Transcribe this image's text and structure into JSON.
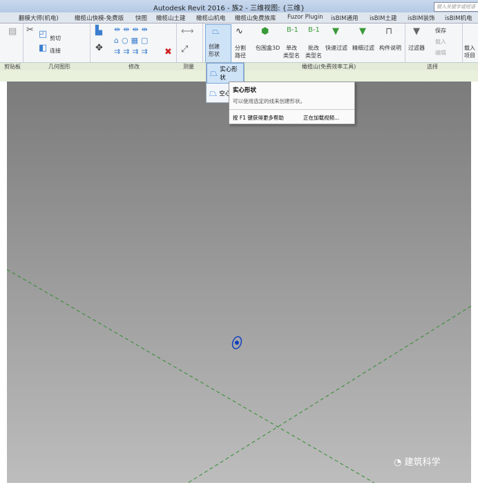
{
  "title": "Autodesk Revit 2016 - 族2 - 三维视图: {三维}",
  "search_placeholder": "键入关键字或短语",
  "tabs": [
    "翻模大师(机电)",
    "橄榄山快模-免费版",
    "快图",
    "橄榄山土建",
    "橄榄山机电",
    "橄榄山免费族库",
    "Fuzor Plugin",
    "isBIM通用",
    "isBIM土建",
    "isBIM装饰",
    "isBIM机电"
  ],
  "ribbon": {
    "cut": "剪切",
    "join": "连接",
    "create_form": "创建\n形状",
    "split_path": "分割\n路径",
    "bbox3d": "包围盒3D",
    "rename_single": "单改\n类型名",
    "rename_batch": "批改\n类型名",
    "quick_filter": "快速过滤",
    "detail_filter": "精细过滤",
    "component_note": "构件说明",
    "filter": "过滤器",
    "save": "保存",
    "load": "载入",
    "edit": "编辑",
    "load_into": "载入\n项目"
  },
  "panels": [
    "剪贴板",
    "几何图形",
    "修改",
    "测量",
    "橄榄山(免费效率工具)",
    "选择"
  ],
  "dropdown": [
    "实心形状",
    "空心形状"
  ],
  "tooltip": {
    "title": "实心形状",
    "desc": "可以使用选定的线来创建形状。",
    "help": "按 F1 键获得更多帮助",
    "video": "正在加载视频..."
  },
  "watermark": "建筑科学",
  "colors": {
    "dash": "#2e8b2e",
    "point": "#1040c0"
  }
}
